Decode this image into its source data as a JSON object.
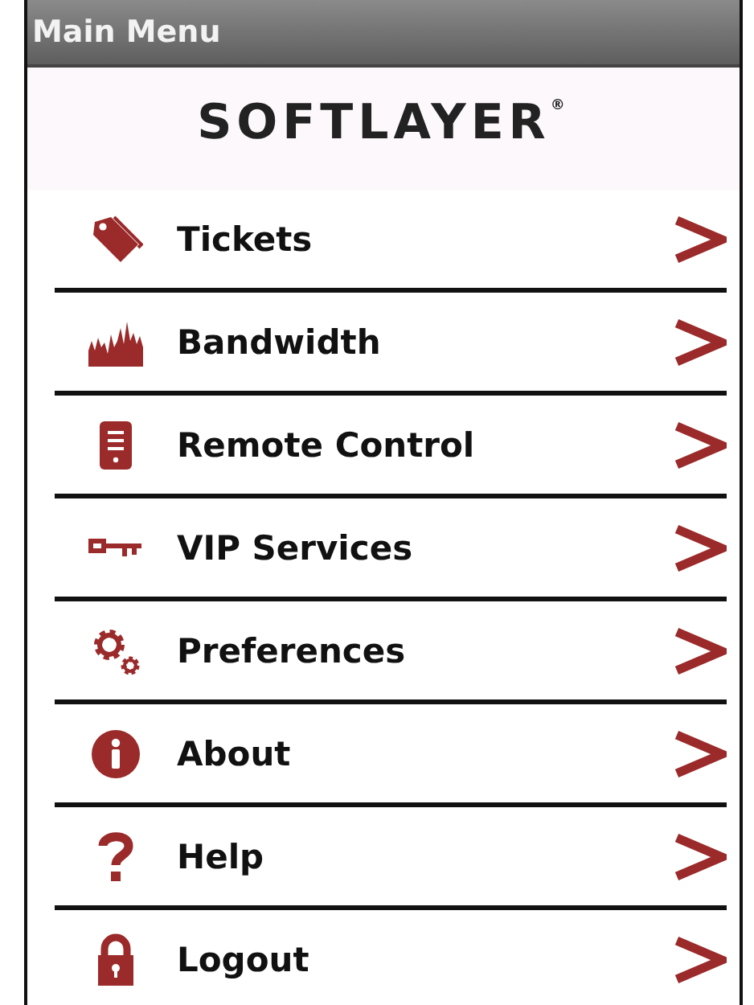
{
  "window": {
    "title": "Main Menu"
  },
  "logo": {
    "text": "SOFTLAYER",
    "mark": "®"
  },
  "menu": [
    {
      "label": "Tickets",
      "kind": "tag"
    },
    {
      "label": "Bandwidth",
      "kind": "graph"
    },
    {
      "label": "Remote Control",
      "kind": "remote"
    },
    {
      "label": "VIP Services",
      "kind": "key"
    },
    {
      "label": "Preferences",
      "kind": "gears"
    },
    {
      "label": "About",
      "kind": "info"
    },
    {
      "label": "Help",
      "kind": "question"
    },
    {
      "label": "Logout",
      "kind": "lock"
    }
  ]
}
